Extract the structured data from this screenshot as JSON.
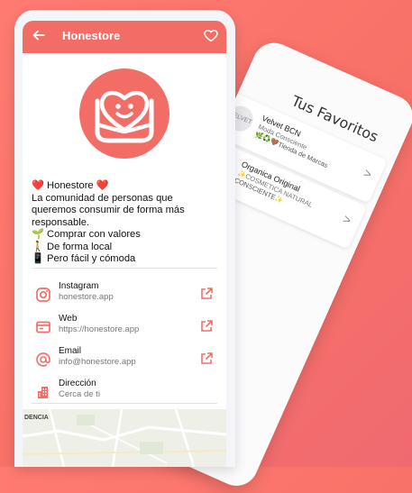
{
  "back_phone": {
    "title": "Tus Favoritos",
    "favorites": [
      {
        "logo_text": "VELVET",
        "name": "Velvet BCN",
        "category": "Moda Consciente",
        "tags": "🌿♻️🤎Tienda de Marcas"
      },
      {
        "logo_text": "",
        "name": "Organica Original",
        "category": "✨COSMETICA NATURAL",
        "tags": "CONSCIENTE✨"
      }
    ],
    "chevron": ">"
  },
  "appbar": {
    "title": "Honestore",
    "back_icon": "arrow-left-icon",
    "favorite_icon": "heart-outline-icon"
  },
  "description": [
    "❤️ Honestore ❤️",
    "La comunidad de personas que",
    "queremos consumir de forma más",
    "responsable.",
    "🌱 Comprar con valores",
    "🚶 De forma local",
    "📱 Pero fácil y cómoda"
  ],
  "contacts": [
    {
      "icon": "instagram-icon",
      "label": "Instagram",
      "value": "honestore.app",
      "external": true
    },
    {
      "icon": "web-card-icon",
      "label": "Web",
      "value": "https://honestore.app",
      "external": true
    },
    {
      "icon": "email-at-icon",
      "label": "Email",
      "value": "info@honestore.app",
      "external": true
    },
    {
      "icon": "building-icon",
      "label": "Dirección",
      "value": "Cerca de ti",
      "external": false
    }
  ],
  "map": {
    "label": "DENCIA"
  },
  "colors": {
    "accent": "#f36d67",
    "background": "#f87168"
  }
}
